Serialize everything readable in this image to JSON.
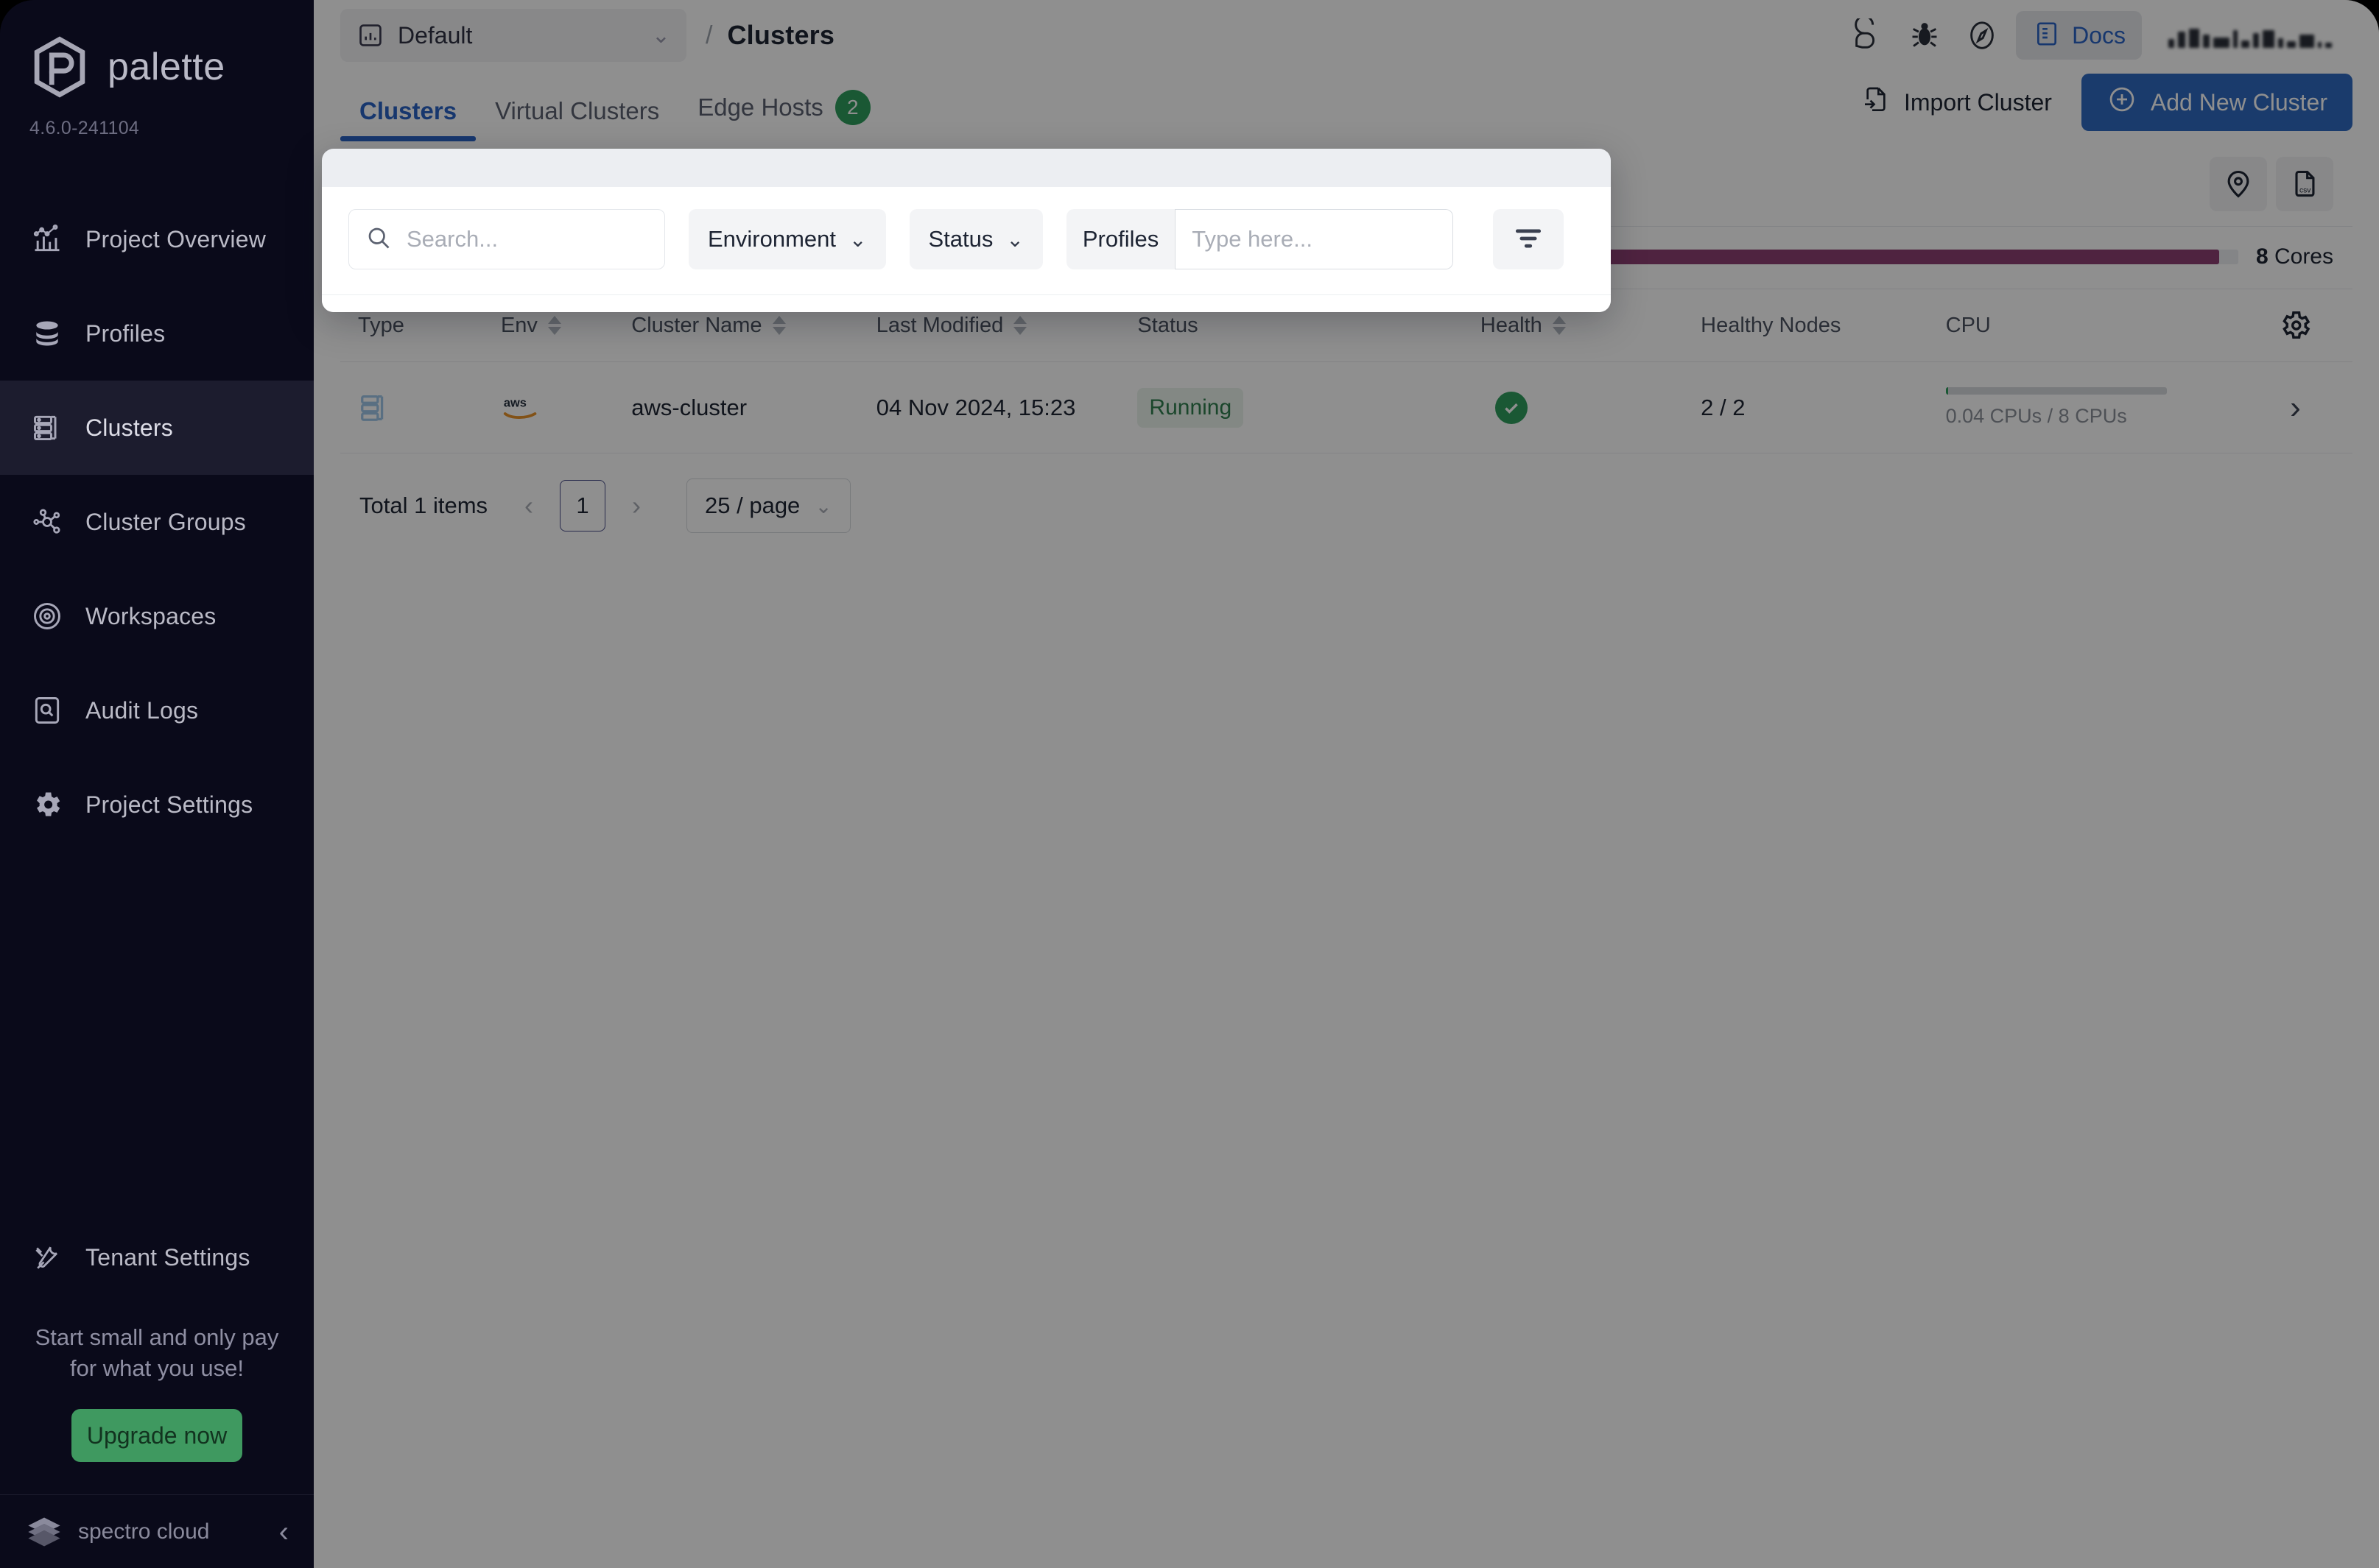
{
  "sidebar": {
    "brand_name": "palette",
    "version": "4.6.0-241104",
    "items": [
      {
        "label": "Project Overview",
        "icon": "chart-bar-icon"
      },
      {
        "label": "Profiles",
        "icon": "layers-stack-icon"
      },
      {
        "label": "Clusters",
        "icon": "server-rack-icon"
      },
      {
        "label": "Cluster Groups",
        "icon": "nodes-network-icon"
      },
      {
        "label": "Workspaces",
        "icon": "target-circles-icon"
      },
      {
        "label": "Audit Logs",
        "icon": "audit-document-icon"
      },
      {
        "label": "Project Settings",
        "icon": "gear-icon"
      }
    ],
    "tenant_settings": {
      "label": "Tenant Settings",
      "icon": "tools-icon"
    },
    "promo": {
      "line1": "Start small and only pay",
      "line2": "for what you use!",
      "button_label": "Upgrade now",
      "button_color": "#3f9960"
    },
    "footer": {
      "company": "spectro cloud",
      "collapse_icon": "chevron-left-icon"
    }
  },
  "header": {
    "project_selector": {
      "value": "Default",
      "icon": "chart-square-icon",
      "caret": "chevron-down-icon"
    },
    "breadcrumb_separator": "/",
    "breadcrumb_title": "Clusters",
    "icons": [
      {
        "name": "chat-bubbles-icon"
      },
      {
        "name": "bug-icon"
      },
      {
        "name": "compass-icon"
      }
    ],
    "docs": {
      "label": "Docs",
      "icon": "book-icon",
      "color": "#2a63c4"
    }
  },
  "tabs": {
    "items": [
      {
        "label": "Clusters",
        "active": true,
        "badge": null
      },
      {
        "label": "Virtual Clusters",
        "active": false,
        "badge": null
      },
      {
        "label": "Edge Hosts",
        "active": false,
        "badge": "2"
      }
    ],
    "badge_color": "#2f9e5e",
    "actions": {
      "import_label": "Import Cluster",
      "import_icon": "file-import-icon",
      "add_label": "Add New Cluster",
      "add_icon": "plus-circle-icon",
      "add_color": "#2f6ac0"
    }
  },
  "toolbar": {
    "map_icon": "map-pin-icon",
    "csv_icon": "csv-file-icon"
  },
  "cores": {
    "label_value": "8",
    "label_unit": "Cores",
    "percent": 99,
    "bar_color": "#8e3f72"
  },
  "filter_panel": {
    "search_placeholder": "Search...",
    "search_value": "",
    "search_icon": "search-icon",
    "environment_label": "Environment",
    "environment_caret": "chevron-down-icon",
    "status_label": "Status",
    "status_caret": "chevron-down-icon",
    "profiles_label": "Profiles",
    "profiles_placeholder": "Type here...",
    "profiles_value": "",
    "filter_icon": "filter-funnel-icon"
  },
  "table": {
    "columns": [
      {
        "label": "Type",
        "sortable": false
      },
      {
        "label": "Env",
        "sortable": true
      },
      {
        "label": "Cluster Name",
        "sortable": true
      },
      {
        "label": "Last Modified",
        "sortable": true
      },
      {
        "label": "Status",
        "sortable": false
      },
      {
        "label": "Health",
        "sortable": true
      },
      {
        "label": "Healthy Nodes",
        "sortable": false
      },
      {
        "label": "CPU",
        "sortable": false
      }
    ],
    "settings_icon": "gear-icon",
    "rows": [
      {
        "type_icon": "server-rack-icon",
        "env": "aws",
        "env_icon": "aws-logo-icon",
        "cluster_name": "aws-cluster",
        "last_modified": "04 Nov 2024, 15:23",
        "status": "Running",
        "status_color": "#2f7d4e",
        "health": "healthy",
        "health_icon": "check-circle-icon",
        "healthy_nodes": "2 / 2",
        "cpu_text": "0.04 CPUs / 8 CPUs",
        "cpu_percent": 1,
        "expand_icon": "chevron-right-icon"
      }
    ]
  },
  "pagination": {
    "total_label": "Total 1 items",
    "prev_icon": "chevron-left-icon",
    "next_icon": "chevron-right-icon",
    "current_page": "1",
    "page_size": "25 / page",
    "page_size_caret": "chevron-down-icon"
  }
}
